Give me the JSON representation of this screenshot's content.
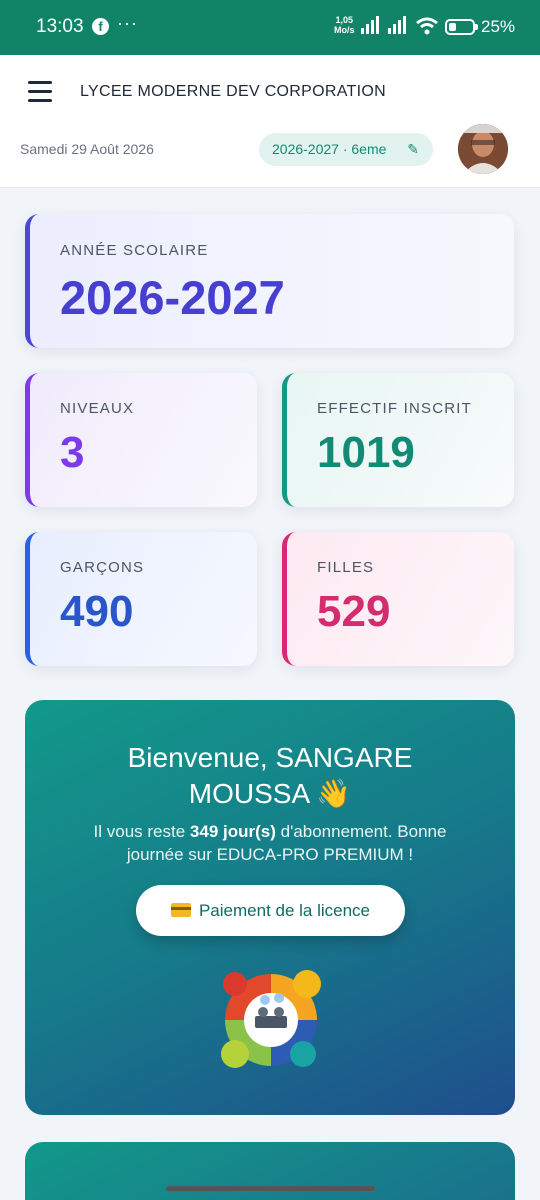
{
  "status_bar": {
    "time": "13:03",
    "speed_value": "1,05",
    "speed_unit": "Mo/s",
    "battery_pct": "25%",
    "battery_level": 0.25
  },
  "header": {
    "school_name": "LYCEE MODERNE DEV CORPORATION",
    "date": "Samedi 29 Août 2026",
    "period_chip": "2026-2027 · 6eme",
    "chip_icon": "pencil-icon",
    "menu_icon": "hamburger-menu-icon"
  },
  "stats": {
    "year": {
      "label": "ANNÉE SCOLAIRE",
      "value": "2026-2027"
    },
    "niveaux": {
      "label": "NIVEAUX",
      "value": "3"
    },
    "effectif": {
      "label": "EFFECTIF INSCRIT",
      "value": "1019"
    },
    "garcons": {
      "label": "GARÇONS",
      "value": "490"
    },
    "filles": {
      "label": "FILLES",
      "value": "529"
    }
  },
  "welcome": {
    "title": "Bienvenue, SANGARE MOUSSA 👋",
    "sub_prefix": "Il vous reste ",
    "sub_days": "349 jour(s)",
    "sub_suffix": " d'abonnement. Bonne journée sur EDUCA-PRO PREMIUM !",
    "button_label": "Paiement de la licence",
    "button_icon": "credit-card-icon"
  },
  "colors": {
    "status_bar": "#118468",
    "year": "#473fcf",
    "niveaux": "#7c3aed",
    "effectif": "#128a74",
    "garcons": "#2956c9",
    "filles": "#d42c6f"
  }
}
